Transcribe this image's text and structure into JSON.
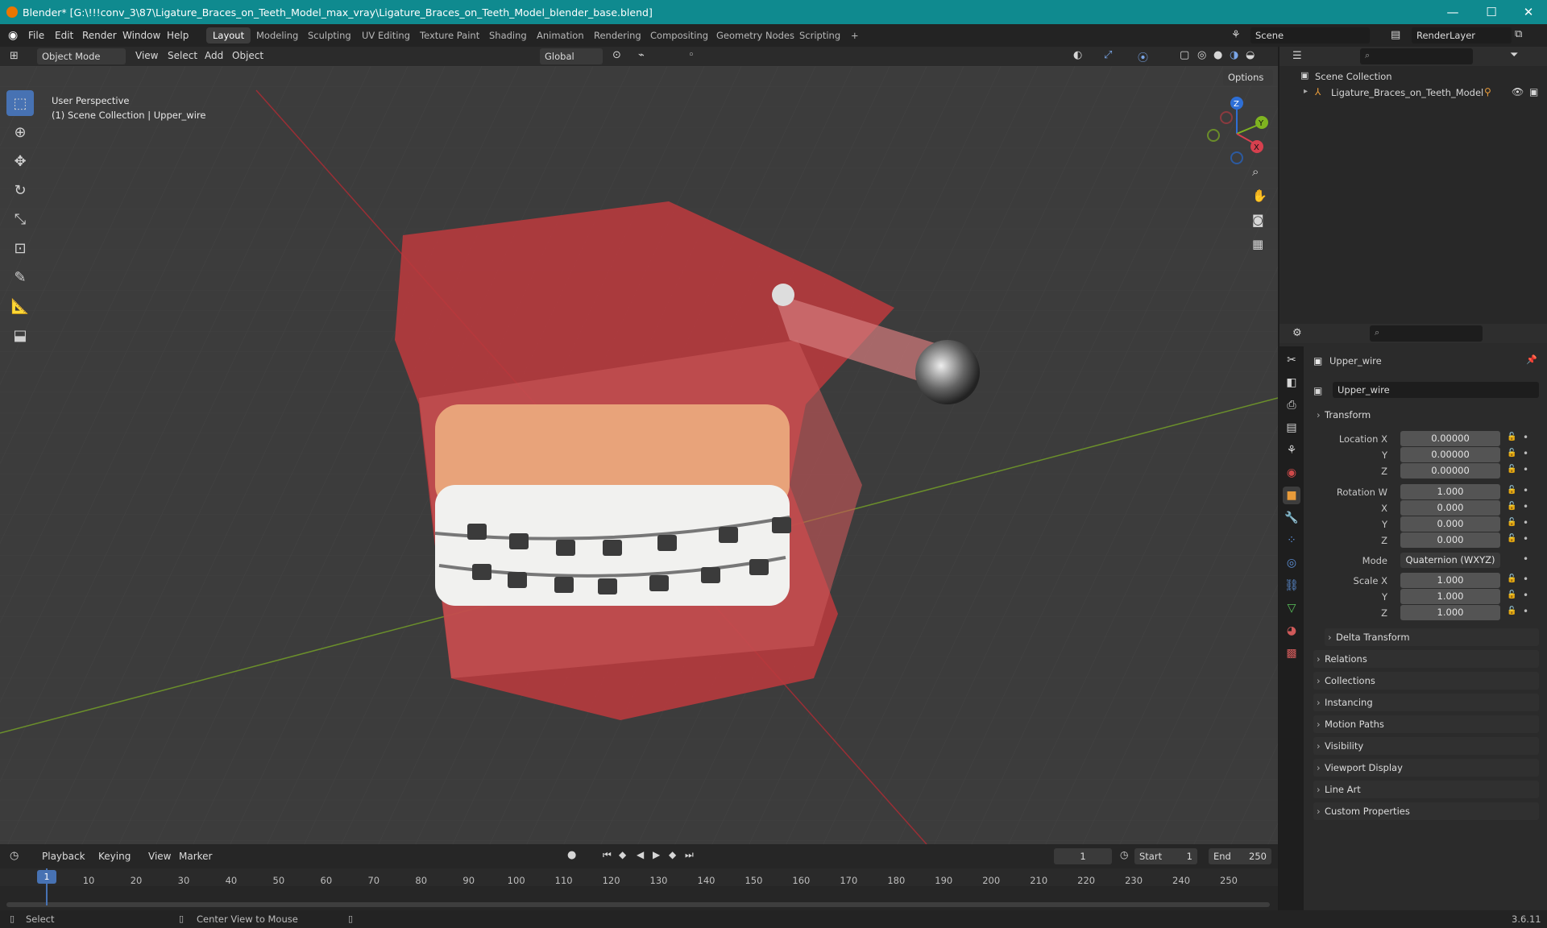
{
  "window": {
    "title": "Blender* [G:\\!!!conv_3\\87\\Ligature_Braces_on_Teeth_Model_max_vray\\Ligature_Braces_on_Teeth_Model_blender_base.blend]",
    "min": "—",
    "max": "☐",
    "close": "✕"
  },
  "menus": [
    "File",
    "Edit",
    "Render",
    "Window",
    "Help"
  ],
  "workspaces": [
    "Layout",
    "Modeling",
    "Sculpting",
    "UV Editing",
    "Texture Paint",
    "Shading",
    "Animation",
    "Rendering",
    "Compositing",
    "Geometry Nodes",
    "Scripting"
  ],
  "add_workspace": "+",
  "scene": {
    "label": "Scene",
    "render_layer": "RenderLayer"
  },
  "viewport": {
    "mode": "Object Mode",
    "menu": [
      "View",
      "Select",
      "Add",
      "Object"
    ],
    "orientation": "Global",
    "options": "Options",
    "overlay_line1": "User Perspective",
    "overlay_line2": "(1) Scene Collection | Upper_wire"
  },
  "gizmo": {
    "z": "Z",
    "y": "Y",
    "x": "X"
  },
  "outliner": {
    "root": "Scene Collection",
    "item": "Ligature_Braces_on_Teeth_Model"
  },
  "properties": {
    "object_name": "Upper_wire",
    "data_name": "Upper_wire",
    "transform": "Transform",
    "loc_label": "Location X",
    "loc": [
      "0.00000",
      "0.00000",
      "0.00000"
    ],
    "rot_label": "Rotation W",
    "rot": [
      "1.000",
      "0.000",
      "0.000",
      "0.000"
    ],
    "mode_label": "Mode",
    "mode": "Quaternion (WXYZ)",
    "scale_label": "Scale X",
    "scale": [
      "1.000",
      "1.000",
      "1.000"
    ],
    "y": "Y",
    "z": "Z",
    "x": "X",
    "delta": "Delta Transform",
    "sections": [
      "Relations",
      "Collections",
      "Instancing",
      "Motion Paths",
      "Visibility",
      "Viewport Display",
      "Line Art",
      "Custom Properties"
    ]
  },
  "timeline": {
    "menus": [
      "Playback",
      "Keying",
      "View",
      "Marker"
    ],
    "current": "1",
    "start_label": "Start",
    "start": "1",
    "end_label": "End",
    "end": "250",
    "ticks": [
      "1",
      "10",
      "20",
      "30",
      "40",
      "50",
      "60",
      "70",
      "80",
      "90",
      "100",
      "110",
      "120",
      "130",
      "140",
      "150",
      "160",
      "170",
      "180",
      "190",
      "200",
      "210",
      "220",
      "230",
      "240",
      "250"
    ]
  },
  "status": {
    "select": "Select",
    "center": "Center View to Mouse",
    "version": "3.6.11"
  }
}
